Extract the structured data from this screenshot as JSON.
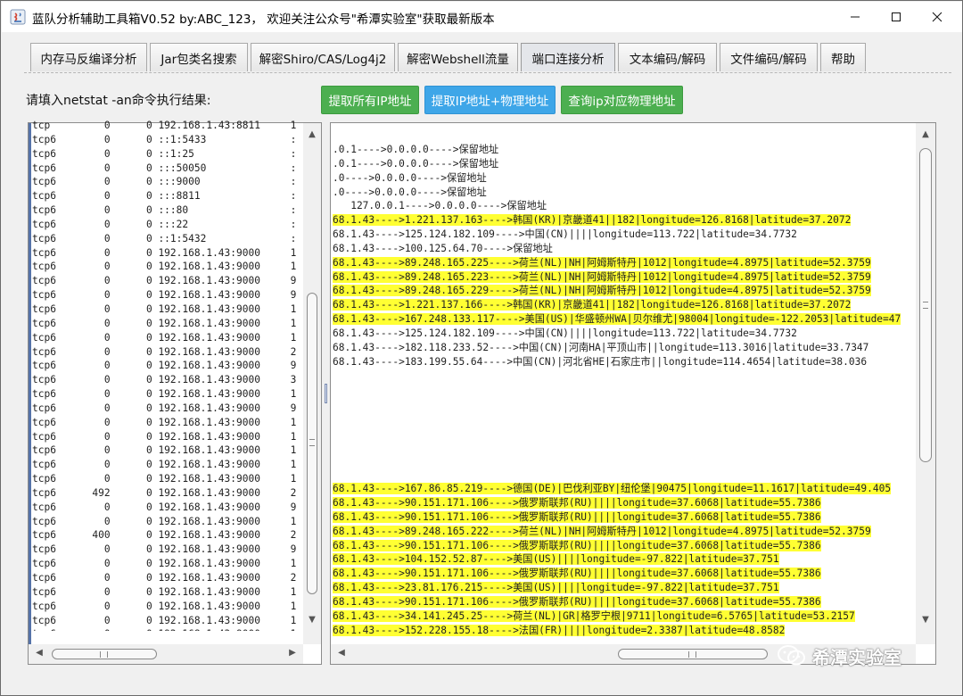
{
  "window": {
    "title": "蓝队分析辅助工具箱V0.52 by:ABC_123， 欢迎关注公众号\"希潭实验室\"获取最新版本",
    "minimize_icon": "minimize-icon",
    "maximize_icon": "maximize-icon",
    "close_icon": "close-icon"
  },
  "tabs": [
    {
      "label": "内存马反编译分析"
    },
    {
      "label": "Jar包类名搜索"
    },
    {
      "label": "解密Shiro/CAS/Log4j2"
    },
    {
      "label": "解密Webshell流量"
    },
    {
      "label": "端口连接分析"
    },
    {
      "label": "文本编码/解码"
    },
    {
      "label": "文件编码/解码"
    },
    {
      "label": "帮助"
    }
  ],
  "active_tab": "端口连接分析",
  "prompt_label": "请填入netstat -an命令执行结果:",
  "buttons": {
    "extract_ip": "提取所有IP地址",
    "extract_ip_physical": "提取IP地址+物理地址",
    "query_ip_physical": "查询ip对应物理地址"
  },
  "colors": {
    "green_button": "#4caf50",
    "blue_button": "#3ea6e8",
    "highlight": "#ffff33"
  },
  "netstat_lines": [
    {
      "proto": "tcp",
      "recv": "0",
      "send": "0",
      "addr": "192.168.1.43:8811",
      "tail": "1"
    },
    {
      "proto": "tcp6",
      "recv": "0",
      "send": "0",
      "addr": "::1:5433",
      "tail": ":"
    },
    {
      "proto": "tcp6",
      "recv": "0",
      "send": "0",
      "addr": "::1:25",
      "tail": ":"
    },
    {
      "proto": "tcp6",
      "recv": "0",
      "send": "0",
      "addr": ":::50050",
      "tail": ":"
    },
    {
      "proto": "tcp6",
      "recv": "0",
      "send": "0",
      "addr": ":::9000",
      "tail": ":"
    },
    {
      "proto": "tcp6",
      "recv": "0",
      "send": "0",
      "addr": ":::8811",
      "tail": ":"
    },
    {
      "proto": "tcp6",
      "recv": "0",
      "send": "0",
      "addr": ":::80",
      "tail": ":"
    },
    {
      "proto": "tcp6",
      "recv": "0",
      "send": "0",
      "addr": ":::22",
      "tail": ":"
    },
    {
      "proto": "tcp6",
      "recv": "0",
      "send": "0",
      "addr": "::1:5432",
      "tail": ":"
    },
    {
      "proto": "tcp6",
      "recv": "0",
      "send": "0",
      "addr": "192.168.1.43:9000",
      "tail": "1"
    },
    {
      "proto": "tcp6",
      "recv": "0",
      "send": "0",
      "addr": "192.168.1.43:9000",
      "tail": "1"
    },
    {
      "proto": "tcp6",
      "recv": "0",
      "send": "0",
      "addr": "192.168.1.43:9000",
      "tail": "9"
    },
    {
      "proto": "tcp6",
      "recv": "0",
      "send": "0",
      "addr": "192.168.1.43:9000",
      "tail": "9"
    },
    {
      "proto": "tcp6",
      "recv": "0",
      "send": "0",
      "addr": "192.168.1.43:9000",
      "tail": "1"
    },
    {
      "proto": "tcp6",
      "recv": "0",
      "send": "0",
      "addr": "192.168.1.43:9000",
      "tail": "1"
    },
    {
      "proto": "tcp6",
      "recv": "0",
      "send": "0",
      "addr": "192.168.1.43:9000",
      "tail": "1"
    },
    {
      "proto": "tcp6",
      "recv": "0",
      "send": "0",
      "addr": "192.168.1.43:9000",
      "tail": "2"
    },
    {
      "proto": "tcp6",
      "recv": "0",
      "send": "0",
      "addr": "192.168.1.43:9000",
      "tail": "9"
    },
    {
      "proto": "tcp6",
      "recv": "0",
      "send": "0",
      "addr": "192.168.1.43:9000",
      "tail": "3"
    },
    {
      "proto": "tcp6",
      "recv": "0",
      "send": "0",
      "addr": "192.168.1.43:9000",
      "tail": "1"
    },
    {
      "proto": "tcp6",
      "recv": "0",
      "send": "0",
      "addr": "192.168.1.43:9000",
      "tail": "9"
    },
    {
      "proto": "tcp6",
      "recv": "0",
      "send": "0",
      "addr": "192.168.1.43:9000",
      "tail": "1"
    },
    {
      "proto": "tcp6",
      "recv": "0",
      "send": "0",
      "addr": "192.168.1.43:9000",
      "tail": "1"
    },
    {
      "proto": "tcp6",
      "recv": "0",
      "send": "0",
      "addr": "192.168.1.43:9000",
      "tail": "1"
    },
    {
      "proto": "tcp6",
      "recv": "0",
      "send": "0",
      "addr": "192.168.1.43:9000",
      "tail": "1"
    },
    {
      "proto": "tcp6",
      "recv": "0",
      "send": "0",
      "addr": "192.168.1.43:9000",
      "tail": "1"
    },
    {
      "proto": "tcp6",
      "recv": "492",
      "send": "0",
      "addr": "192.168.1.43:9000",
      "tail": "2"
    },
    {
      "proto": "tcp6",
      "recv": "0",
      "send": "0",
      "addr": "192.168.1.43:9000",
      "tail": "9"
    },
    {
      "proto": "tcp6",
      "recv": "0",
      "send": "0",
      "addr": "192.168.1.43:9000",
      "tail": "1"
    },
    {
      "proto": "tcp6",
      "recv": "400",
      "send": "0",
      "addr": "192.168.1.43:9000",
      "tail": "2"
    },
    {
      "proto": "tcp6",
      "recv": "0",
      "send": "0",
      "addr": "192.168.1.43:9000",
      "tail": "9"
    },
    {
      "proto": "tcp6",
      "recv": "0",
      "send": "0",
      "addr": "192.168.1.43:9000",
      "tail": "1"
    },
    {
      "proto": "tcp6",
      "recv": "0",
      "send": "0",
      "addr": "192.168.1.43:9000",
      "tail": "2"
    },
    {
      "proto": "tcp6",
      "recv": "0",
      "send": "0",
      "addr": "192.168.1.43:9000",
      "tail": "1"
    },
    {
      "proto": "tcp6",
      "recv": "0",
      "send": "0",
      "addr": "192.168.1.43:9000",
      "tail": "1"
    },
    {
      "proto": "tcp6",
      "recv": "0",
      "send": "0",
      "addr": "192.168.1.43:9000",
      "tail": "1"
    },
    {
      "proto": "tcp6",
      "recv": "0",
      "send": "0",
      "addr": "192.168.1.43:9000",
      "tail": "1"
    },
    {
      "proto": "tcp6",
      "recv": "0",
      "send": "0",
      "addr": "192.168.1.43:9000",
      "tail": "1"
    }
  ],
  "result_lines": [
    {
      "text": ".0.1---->0.0.0.0---->保留地址",
      "highlight": false
    },
    {
      "text": ".0.1---->0.0.0.0---->保留地址",
      "highlight": false
    },
    {
      "text": ".0---->0.0.0.0---->保留地址",
      "highlight": false
    },
    {
      "text": ".0---->0.0.0.0---->保留地址",
      "highlight": false
    },
    {
      "text": "   127.0.0.1---->0.0.0.0---->保留地址",
      "highlight": false
    },
    {
      "text": "68.1.43---->1.221.137.163---->韩国(KR)|京畿道41||182|longitude=126.8168|latitude=37.2072",
      "highlight": true
    },
    {
      "text": "68.1.43---->125.124.182.109---->中国(CN)||||longitude=113.722|latitude=34.7732",
      "highlight": false
    },
    {
      "text": "68.1.43---->100.125.64.70---->保留地址",
      "highlight": false
    },
    {
      "text": "68.1.43---->89.248.165.225---->荷兰(NL)|NH|阿姆斯特丹|1012|longitude=4.8975|latitude=52.3759",
      "highlight": true
    },
    {
      "text": "68.1.43---->89.248.165.223---->荷兰(NL)|NH|阿姆斯特丹|1012|longitude=4.8975|latitude=52.3759",
      "highlight": true
    },
    {
      "text": "68.1.43---->89.248.165.229---->荷兰(NL)|NH|阿姆斯特丹|1012|longitude=4.8975|latitude=52.3759",
      "highlight": true
    },
    {
      "text": "68.1.43---->1.221.137.166---->韩国(KR)|京畿道41||182|longitude=126.8168|latitude=37.2072",
      "highlight": true
    },
    {
      "text": "68.1.43---->167.248.133.117---->美国(US)|华盛顿州WA|贝尔维尤|98004|longitude=-122.2053|latitude=47",
      "highlight": true
    },
    {
      "text": "68.1.43---->125.124.182.109---->中国(CN)||||longitude=113.722|latitude=34.7732",
      "highlight": false
    },
    {
      "text": "68.1.43---->182.118.233.52---->中国(CN)|河南HA|平顶山市||longitude=113.3016|latitude=33.7347",
      "highlight": false
    },
    {
      "text": "68.1.43---->183.199.55.64---->中国(CN)|河北省HE|石家庄市||longitude=114.4654|latitude=38.036",
      "highlight": false
    },
    {
      "text": "",
      "highlight": false
    },
    {
      "text": "",
      "highlight": false
    },
    {
      "text": "",
      "highlight": false
    },
    {
      "text": "",
      "highlight": false
    },
    {
      "text": "",
      "highlight": false
    },
    {
      "text": "",
      "highlight": false
    },
    {
      "text": "",
      "highlight": false
    },
    {
      "text": "",
      "highlight": false
    },
    {
      "text": "68.1.43---->167.86.85.219---->德国(DE)|巴伐利亚BY|纽伦堡|90475|longitude=11.1617|latitude=49.405",
      "highlight": true
    },
    {
      "text": "68.1.43---->90.151.171.106---->俄罗斯联邦(RU)||||longitude=37.6068|latitude=55.7386",
      "highlight": true
    },
    {
      "text": "68.1.43---->90.151.171.106---->俄罗斯联邦(RU)||||longitude=37.6068|latitude=55.7386",
      "highlight": true
    },
    {
      "text": "68.1.43---->89.248.165.222---->荷兰(NL)|NH|阿姆斯特丹|1012|longitude=4.8975|latitude=52.3759",
      "highlight": true
    },
    {
      "text": "68.1.43---->90.151.171.106---->俄罗斯联邦(RU)||||longitude=37.6068|latitude=55.7386",
      "highlight": true
    },
    {
      "text": "68.1.43---->104.152.52.87---->美国(US)||||longitude=-97.822|latitude=37.751",
      "highlight": true
    },
    {
      "text": "68.1.43---->90.151.171.106---->俄罗斯联邦(RU)||||longitude=37.6068|latitude=55.7386",
      "highlight": true
    },
    {
      "text": "68.1.43---->23.81.176.215---->美国(US)||||longitude=-97.822|latitude=37.751",
      "highlight": true
    },
    {
      "text": "68.1.43---->90.151.171.106---->俄罗斯联邦(RU)||||longitude=37.6068|latitude=55.7386",
      "highlight": true
    },
    {
      "text": "68.1.43---->34.141.245.25---->荷兰(NL)|GR|格罗宁根|9711|longitude=6.5765|latitude=53.2157",
      "highlight": true
    },
    {
      "text": "68.1.43---->152.228.155.18---->法国(FR)||||longitude=2.3387|latitude=48.8582",
      "highlight": true
    }
  ],
  "watermark": "希潭实验室",
  "watermark_icon": "wechat-icon"
}
